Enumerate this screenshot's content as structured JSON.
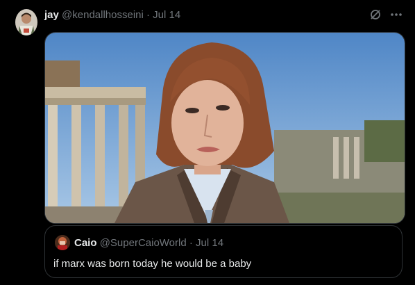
{
  "post": {
    "author_name": "jay",
    "author_handle": "@kendallhosseini",
    "separator": "·",
    "date": "Jul 14",
    "avatar_icon": "user-avatar",
    "grok_icon": "grok-icon",
    "more_icon": "more-icon",
    "image_icon": "photo-woman-roman-forum"
  },
  "quoted_post": {
    "author_name": "Caio",
    "author_handle": "@SuperCaioWorld",
    "separator": "·",
    "date": "Jul 14",
    "text": "if marx was born today he would be a baby",
    "avatar_icon": "user-avatar"
  },
  "colors": {
    "background": "#000000",
    "text_primary": "#e7e9ea",
    "text_secondary": "#71767b",
    "border": "#2f3336"
  }
}
